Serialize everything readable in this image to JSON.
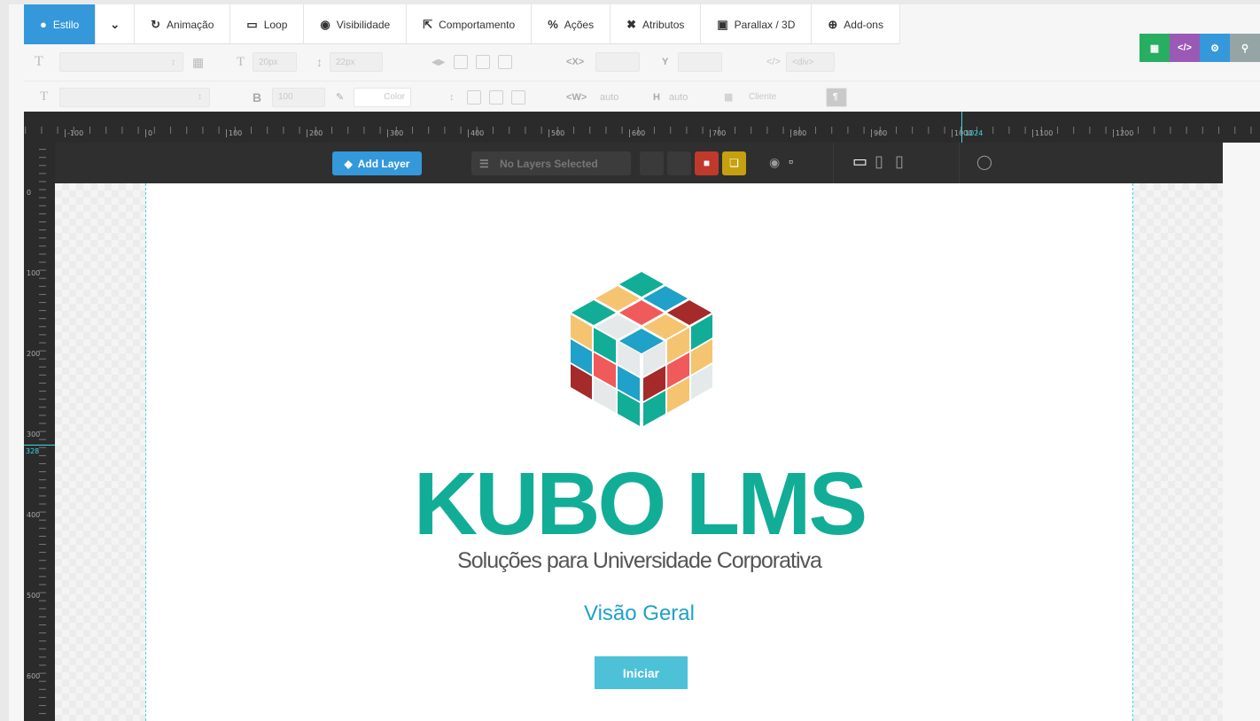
{
  "tabs": [
    {
      "label": "Estilo",
      "icon": "drop-icon"
    },
    {
      "label": "",
      "icon": "chevron-down-icon"
    },
    {
      "label": "Animação",
      "icon": "history-icon"
    },
    {
      "label": "Loop",
      "icon": "loop-icon"
    },
    {
      "label": "Visibilidade",
      "icon": "eye-icon"
    },
    {
      "label": "Comportamento",
      "icon": "expand-icon"
    },
    {
      "label": "Ações",
      "icon": "link-icon"
    },
    {
      "label": "Atributos",
      "icon": "tools-icon"
    },
    {
      "label": "Parallax / 3D",
      "icon": "image-icon"
    },
    {
      "label": "Add-ons",
      "icon": "plus-circle-icon"
    }
  ],
  "toolbar": {
    "font_size": "20px",
    "line_height": "22px",
    "x_label": "X",
    "y_label": "Y",
    "tag": "<div>",
    "font_weight": "100",
    "color_label": "Color",
    "w_label": "W",
    "w_value": "auto",
    "h_label": "H",
    "h_value": "auto",
    "cover": "Cliente"
  },
  "ruler": {
    "labels": [
      "-100",
      "0",
      "100",
      "200",
      "300",
      "400",
      "500",
      "600",
      "700",
      "800",
      "900",
      "1000",
      "1100",
      "1200"
    ],
    "marker": "1024",
    "vlabels": [
      "0",
      "100",
      "200",
      "300",
      "400",
      "500",
      "600"
    ],
    "vmarker": "328"
  },
  "layerbar": {
    "add_layer": "Add Layer",
    "no_layers": "No Layers Selected"
  },
  "slide": {
    "title": "KUBO LMS",
    "subtitle": "Soluções para Universidade Corporativa",
    "vision": "Visão Geral",
    "button": "Iniciar"
  },
  "colors": {
    "accent": "#3498db",
    "brand_green": "#12ad97",
    "vision_blue": "#1fa1c9",
    "button": "#4dc1d8"
  }
}
